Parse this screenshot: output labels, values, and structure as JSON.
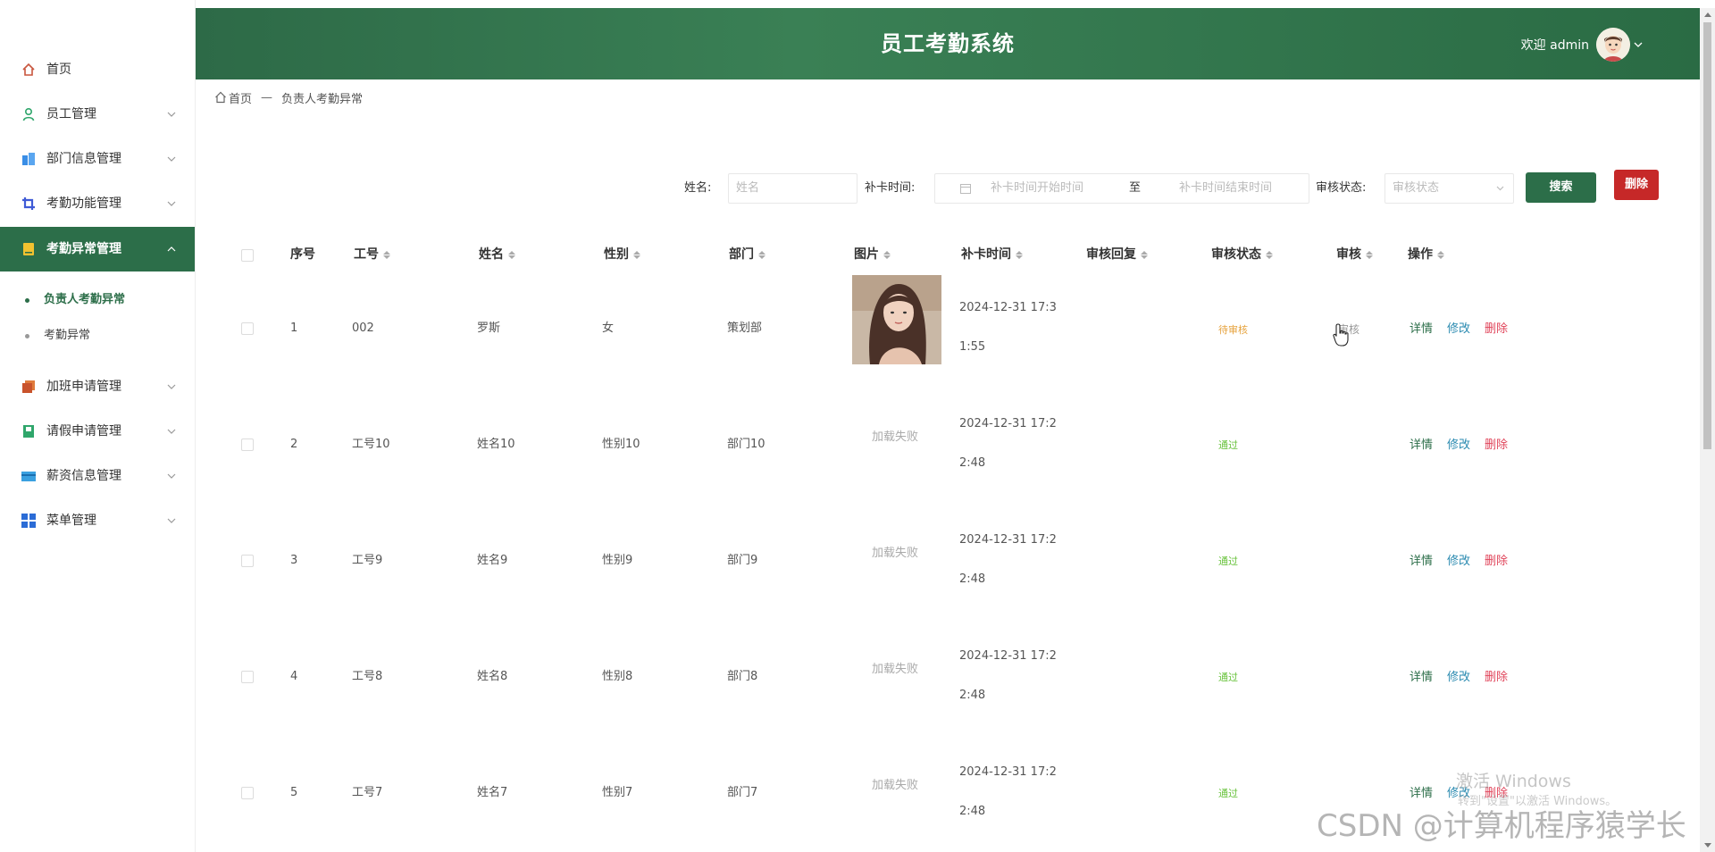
{
  "header": {
    "title": "员工考勤系统",
    "welcome": "欢迎 admin"
  },
  "sidebar": {
    "items": [
      {
        "label": "首页",
        "icon": "home-icon",
        "has_arrow": false
      },
      {
        "label": "员工管理",
        "icon": "person-icon",
        "has_arrow": true
      },
      {
        "label": "部门信息管理",
        "icon": "building-icon",
        "has_arrow": true
      },
      {
        "label": "考勤功能管理",
        "icon": "crop-icon",
        "has_arrow": true
      },
      {
        "label": "考勤异常管理",
        "icon": "notebook-icon",
        "has_arrow": true,
        "active": true,
        "children": [
          {
            "label": "负责人考勤异常",
            "active": true
          },
          {
            "label": "考勤异常",
            "active": false
          }
        ]
      },
      {
        "label": "加班申请管理",
        "icon": "copy-icon",
        "has_arrow": true
      },
      {
        "label": "请假申请管理",
        "icon": "book-icon",
        "has_arrow": true
      },
      {
        "label": "薪资信息管理",
        "icon": "card-icon",
        "has_arrow": true
      },
      {
        "label": "菜单管理",
        "icon": "grid-icon",
        "has_arrow": true
      }
    ]
  },
  "breadcrumb": {
    "home": "首页",
    "separator": "—",
    "current": "负责人考勤异常"
  },
  "search": {
    "name_label": "姓名:",
    "name_placeholder": "姓名",
    "time_label": "补卡时间:",
    "time_start_placeholder": "补卡时间开始时间",
    "time_to": "至",
    "time_end_placeholder": "补卡时间结束时间",
    "status_label": "审核状态:",
    "status_placeholder": "审核状态",
    "search_button": "搜索",
    "delete_button": "删除"
  },
  "table": {
    "columns": [
      "序号",
      "工号",
      "姓名",
      "性别",
      "部门",
      "图片",
      "补卡时间",
      "审核回复",
      "审核状态",
      "审核",
      "操作"
    ],
    "rows": [
      {
        "index": "1",
        "emp_no": "002",
        "name": "罗斯",
        "gender": "女",
        "dept": "策划部",
        "image": "photo",
        "time": "2024-12-31 17:31:55",
        "reply": "",
        "status": "待审核",
        "status_type": "pending",
        "review": "审核"
      },
      {
        "index": "2",
        "emp_no": "工号10",
        "name": "姓名10",
        "gender": "性别10",
        "dept": "部门10",
        "image": "加载失败",
        "time": "2024-12-31 17:22:48",
        "reply": "",
        "status": "通过",
        "status_type": "pass",
        "review": ""
      },
      {
        "index": "3",
        "emp_no": "工号9",
        "name": "姓名9",
        "gender": "性别9",
        "dept": "部门9",
        "image": "加载失败",
        "time": "2024-12-31 17:22:48",
        "reply": "",
        "status": "通过",
        "status_type": "pass",
        "review": ""
      },
      {
        "index": "4",
        "emp_no": "工号8",
        "name": "姓名8",
        "gender": "性别8",
        "dept": "部门8",
        "image": "加载失败",
        "time": "2024-12-31 17:22:48",
        "reply": "",
        "status": "通过",
        "status_type": "pass",
        "review": ""
      },
      {
        "index": "5",
        "emp_no": "工号7",
        "name": "姓名7",
        "gender": "性别7",
        "dept": "部门7",
        "image": "加载失败",
        "time": "2024-12-31 17:22:48",
        "reply": "",
        "status": "通过",
        "status_type": "pass",
        "review": ""
      }
    ],
    "actions": {
      "detail": "详情",
      "edit": "修改",
      "delete": "删除"
    }
  },
  "colors": {
    "primary": "#2c6e49",
    "danger": "#c62828",
    "pending": "#e6a23c",
    "pass": "#67c23a",
    "edit": "#2a8ab0",
    "delete_link": "#e0445a"
  },
  "watermarks": {
    "windows_title": "激活 Windows",
    "windows_sub": "转到\"设置\"以激活 Windows。",
    "csdn": "CSDN @计算机程序猿学长"
  }
}
